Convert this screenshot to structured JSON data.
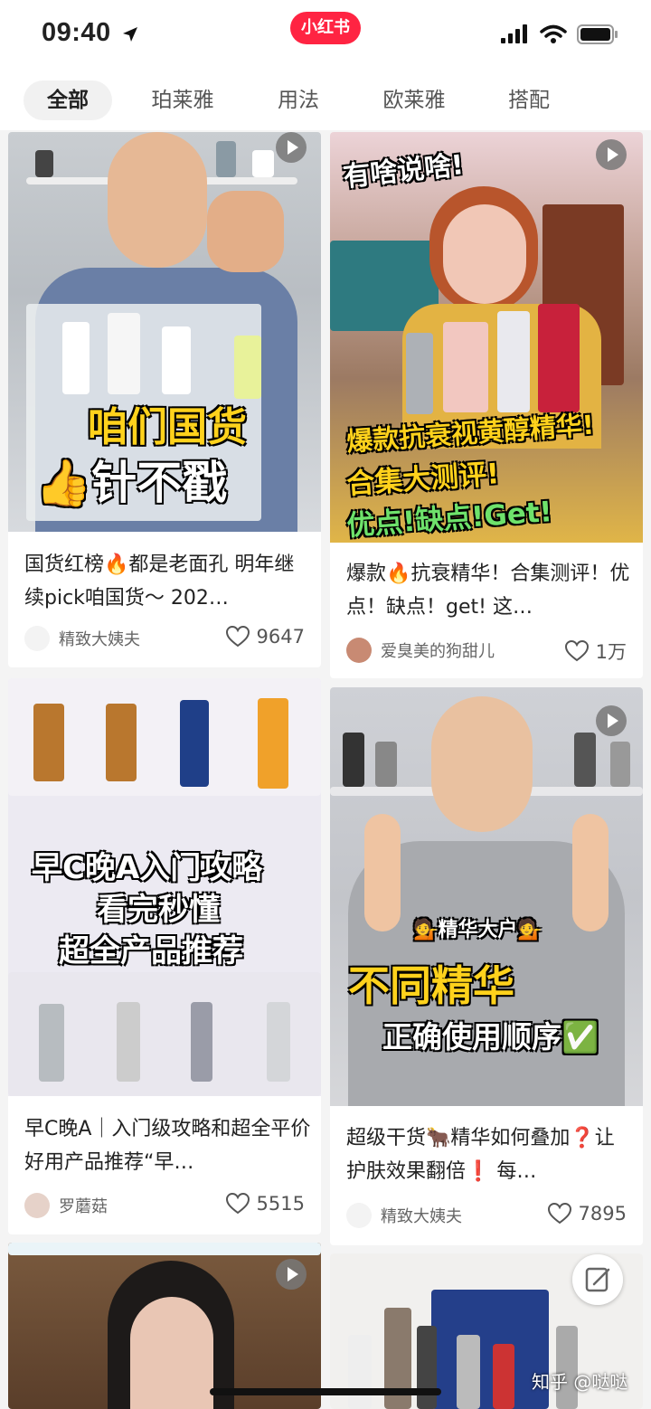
{
  "status_bar": {
    "time": "09:40",
    "app_logo": "小红书"
  },
  "tabs": [
    {
      "label": "全部",
      "active": true
    },
    {
      "label": "珀莱雅",
      "active": false
    },
    {
      "label": "用法",
      "active": false
    },
    {
      "label": "欧莱雅",
      "active": false
    },
    {
      "label": "搭配",
      "active": false
    }
  ],
  "feed": [
    {
      "overlay": [
        "咱们国货",
        "👍针不戳"
      ],
      "title": "国货红榜🔥都是老面孔 明年继续pick咱国货～ 202…",
      "author": "精致大姨夫",
      "likes": "9647",
      "video": true
    },
    {
      "overlay": [
        "有啥说啥!",
        "爆款抗衰视黄醇精华!",
        "合集大测评!",
        "优点!缺点!Get!"
      ],
      "title": "爆款🔥抗衰精华！合集测评！优点！缺点！get! 这…",
      "author": "爱臭美的狗甜儿",
      "likes": "1万",
      "video": true
    },
    {
      "overlay": [
        "早C晚A入门攻略",
        "看完秒懂",
        "超全产品推荐"
      ],
      "title": "早C晚A｜入门级攻略和超全平价好用产品推荐“早…",
      "author": "罗蘑菇",
      "likes": "5515",
      "video": false
    },
    {
      "overlay": [
        "💁精华大户💁",
        "不同精华",
        "正确使用顺序✅"
      ],
      "title": "超级干货🐂精华如何叠加❓让护肤效果翻倍❗ 每…",
      "author": "精致大姨夫",
      "likes": "7895",
      "video": true
    }
  ],
  "watermark": "知乎 @哒哒",
  "colors": {
    "brand": "#ff2442",
    "accent_yellow": "#ffd21c"
  },
  "icons": [
    "location-arrow-icon",
    "signal-icon",
    "wifi-icon",
    "battery-icon",
    "play-icon",
    "heart-icon",
    "edit-icon"
  ]
}
